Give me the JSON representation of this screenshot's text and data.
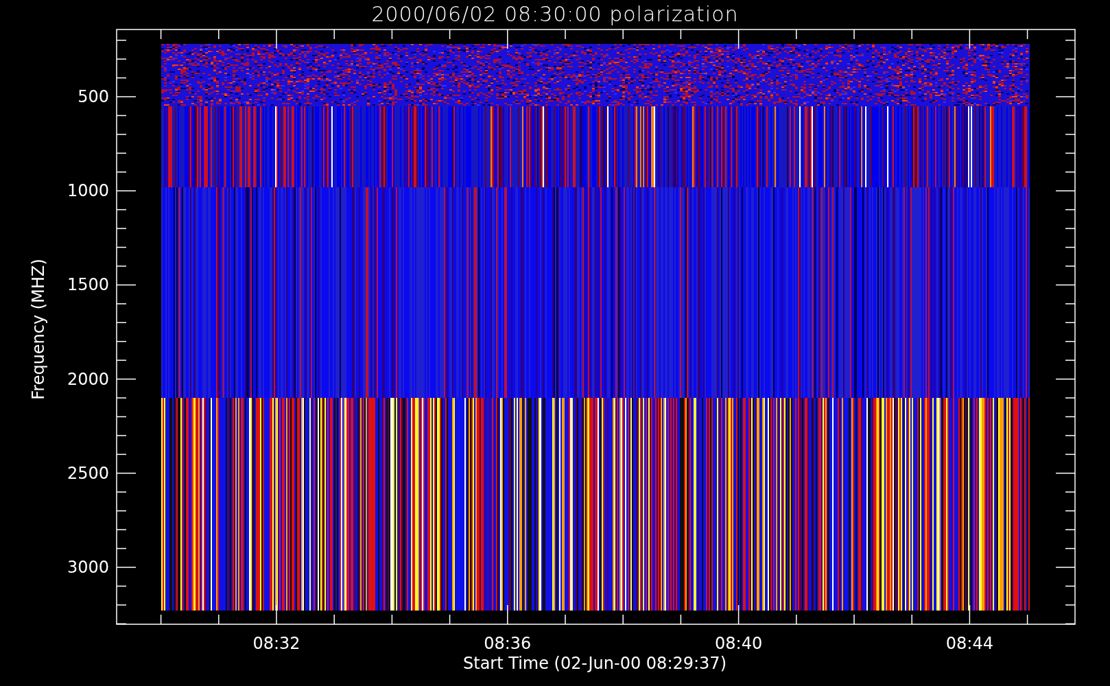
{
  "title": "2000/06/02 08:30:00 polarization",
  "y_axis": {
    "label": "Frequency (MHZ)",
    "ticks": [
      "500",
      "1000",
      "1500",
      "2000",
      "2500",
      "3000"
    ]
  },
  "x_axis": {
    "label": "Start Time (02-Jun-00 08:29:37)",
    "ticks": [
      "08:32",
      "08:36",
      "08:40",
      "08:44"
    ]
  }
}
